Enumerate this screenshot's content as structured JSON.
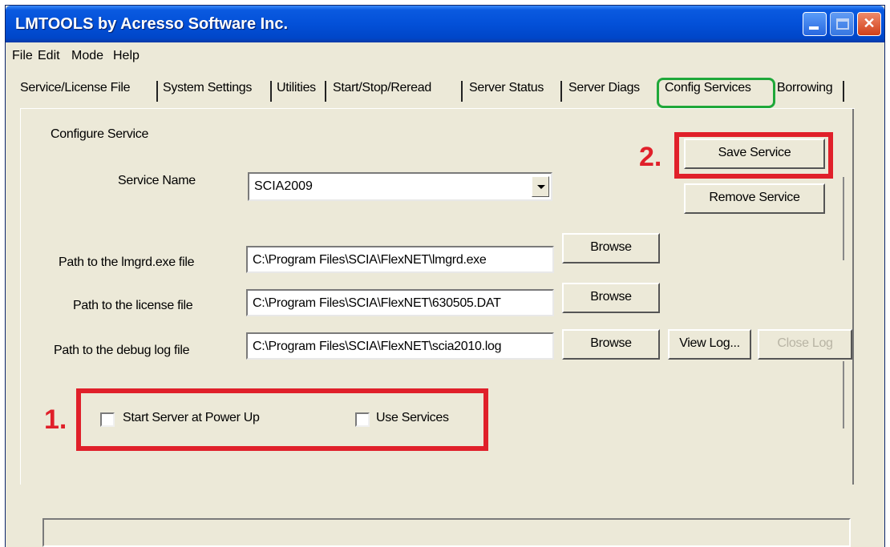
{
  "window": {
    "title": "LMTOOLS by Acresso Software Inc."
  },
  "menu": [
    "File",
    "Edit",
    "Mode",
    "Help"
  ],
  "tabs": [
    {
      "label": "Service/License File",
      "active": false
    },
    {
      "label": "System Settings",
      "active": false
    },
    {
      "label": "Utilities",
      "active": false
    },
    {
      "label": "Start/Stop/Reread",
      "active": false
    },
    {
      "label": "Server Status",
      "active": false
    },
    {
      "label": "Server Diags",
      "active": false
    },
    {
      "label": "Config Services",
      "active": true
    },
    {
      "label": "Borrowing",
      "active": false
    }
  ],
  "config": {
    "section_label": "Configure Service",
    "service_name_label": "Service Name",
    "service_name_value": "SCIA2009",
    "lmgrd_label": "Path to the lmgrd.exe file",
    "lmgrd_value": "C:\\Program Files\\SCIA\\FlexNET\\lmgrd.exe",
    "license_label": "Path to the license file",
    "license_value": "C:\\Program Files\\SCIA\\FlexNET\\630505.DAT",
    "debug_label": "Path to the debug log file",
    "debug_value": "C:\\Program Files\\SCIA\\FlexNET\\scia2010.log",
    "start_power_up_label": "Start Server at Power Up",
    "start_power_up_checked": false,
    "use_services_label": "Use Services",
    "use_services_checked": false
  },
  "buttons": {
    "save_service": "Save Service",
    "remove_service": "Remove Service",
    "browse": "Browse",
    "view_log": "View Log...",
    "close_log": "Close Log"
  },
  "annotations": {
    "step1": "1.",
    "step2": "2.",
    "highlight_color": "#e0202a",
    "active_tab_color": "#1fa83a"
  }
}
